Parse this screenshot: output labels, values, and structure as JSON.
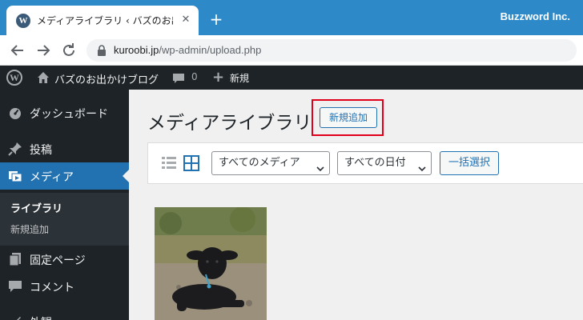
{
  "browser": {
    "tab_title": "メディアライブラリ ‹ バズのお出かけブログ",
    "tab_close": "✕",
    "new_tab": "+",
    "brand": "Buzzword Inc.",
    "url_host": "kuroobi.jp",
    "url_path": "/wp-admin/upload.php",
    "icons": [
      "back-icon",
      "forward-icon",
      "reload-icon",
      "lock-icon"
    ]
  },
  "adminbar": {
    "site_name": "バズのお出かけブログ",
    "comment_count": "0",
    "new_label": "新規"
  },
  "sidebar": {
    "items": [
      {
        "label": "ダッシュボード",
        "icon": "dashboard-icon"
      },
      {
        "label": "投稿",
        "icon": "pin-icon"
      },
      {
        "label": "メディア",
        "icon": "media-icon"
      },
      {
        "label": "固定ページ",
        "icon": "page-icon"
      },
      {
        "label": "コメント",
        "icon": "comment-icon"
      },
      {
        "label": "外観",
        "icon": "appearance-icon"
      }
    ],
    "submenu": [
      {
        "label": "ライブラリ"
      },
      {
        "label": "新規追加"
      }
    ]
  },
  "main": {
    "title": "メディアライブラリ",
    "add_new": "新規追加",
    "filters": {
      "media_type": "すべてのメディア",
      "date": "すべての日付",
      "bulk_select": "一括選択"
    }
  },
  "colors": {
    "tab_strip": "#2e89c9",
    "admin_dark": "#1d2327",
    "wp_blue": "#2271b1",
    "highlight_red": "#e0001b"
  }
}
